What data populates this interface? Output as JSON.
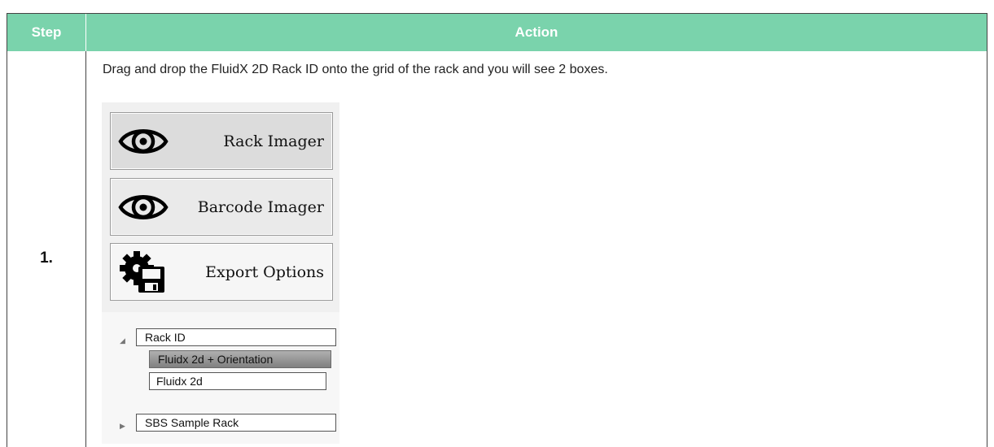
{
  "table": {
    "header_step": "Step",
    "header_action": "Action"
  },
  "step": {
    "number": "1.",
    "instruction": "Drag and drop the FluidX 2D Rack ID onto the grid of the rack and you will see 2 boxes."
  },
  "buttons": {
    "rack_imager": "Rack Imager",
    "barcode_imager": "Barcode Imager",
    "export_options": "Export Options"
  },
  "tree": {
    "rack_id": "Rack ID",
    "fluidx_orientation": "Fluidx 2d + Orientation",
    "fluidx_2d": "Fluidx 2d",
    "sbs_sample_rack": "SBS Sample Rack"
  },
  "icons": {
    "rack_imager": "eye-icon",
    "barcode_imager": "eye-icon",
    "export_options": "gear-floppy-icon",
    "tree_expanded": "triangle-down-icon",
    "tree_collapsed": "triangle-right-icon"
  },
  "colors": {
    "header_bg": "#7ad3ac",
    "header_text": "#ffffff",
    "selected_node": "#909090"
  }
}
